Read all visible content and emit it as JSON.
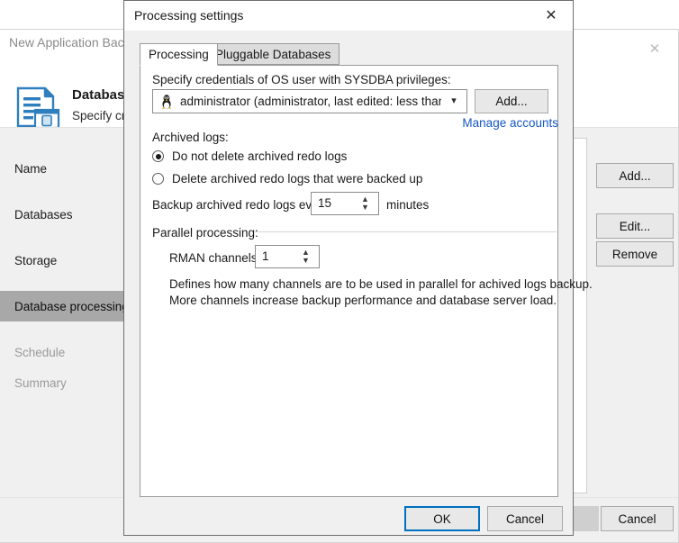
{
  "background_window": {
    "title": "New Application Backup",
    "header_title": "Database pr",
    "header_subtitle": "Specify cred",
    "close_icon": "close-icon",
    "header_icon": "database-document-icon",
    "nav_items": [
      {
        "label": "Name",
        "state": "normal"
      },
      {
        "label": "Databases",
        "state": "normal"
      },
      {
        "label": "Storage",
        "state": "normal"
      },
      {
        "label": "Database processing",
        "state": "selected"
      },
      {
        "label": "Schedule",
        "state": "disabled"
      },
      {
        "label": "Summary",
        "state": "disabled"
      }
    ],
    "side_buttons": [
      {
        "label": "Add..."
      },
      {
        "label": "Edit..."
      },
      {
        "label": "Remove"
      }
    ],
    "footer": {
      "cancel_label": "Cancel"
    }
  },
  "dialog": {
    "title": "Processing settings",
    "close_icon": "close-icon",
    "tabs": [
      {
        "label": "Processing",
        "active": true
      },
      {
        "label": "Pluggable Databases",
        "active": false
      }
    ],
    "credentials": {
      "label": "Specify credentials of OS user with SYSDBA privileges:",
      "selected_account": "administrator (administrator, last edited: less than a...",
      "account_icon": "linux-penguin-icon",
      "dropdown_icon": "chevron-down-icon",
      "add_button": "Add...",
      "manage_link": "Manage accounts",
      "link_color": "#1658c4"
    },
    "archived_logs": {
      "group_label": "Archived logs:",
      "options": [
        {
          "label": "Do not delete archived redo logs",
          "selected": true
        },
        {
          "label": "Delete archived redo logs that were backed up",
          "selected": false
        }
      ],
      "backup_every_label": "Backup archived redo logs every:",
      "backup_every_value": "15",
      "backup_every_unit": "minutes"
    },
    "parallel_processing": {
      "group_label": "Parallel processing:",
      "rman_label": "RMAN channels:",
      "rman_value": "1",
      "description_line1": "Defines how many channels are to be used in parallel for achived logs backup.",
      "description_line2": "More channels increase backup performance and database server load."
    },
    "footer": {
      "ok_label": "OK",
      "cancel_label": "Cancel",
      "focus_color": "#0070c0"
    }
  }
}
